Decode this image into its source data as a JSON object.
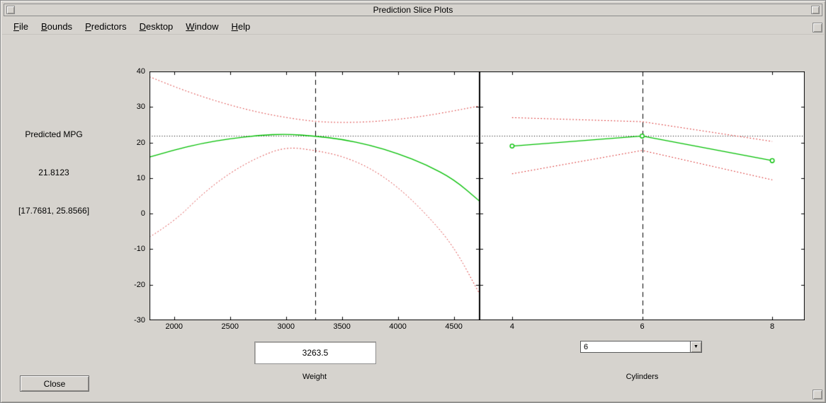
{
  "window": {
    "title": "Prediction Slice Plots"
  },
  "menu_bar": {
    "items": [
      {
        "label": "File",
        "mnemonic": "F",
        "rest": "ile"
      },
      {
        "label": "Bounds",
        "mnemonic": "B",
        "rest": "ounds"
      },
      {
        "label": "Predictors",
        "mnemonic": "P",
        "rest": "redictors"
      },
      {
        "label": "Desktop",
        "mnemonic": "D",
        "rest": "esktop"
      },
      {
        "label": "Window",
        "mnemonic": "W",
        "rest": "indow"
      },
      {
        "label": "Help",
        "mnemonic": "H",
        "rest": "elp"
      }
    ]
  },
  "info_panel": {
    "response_label": "Predicted MPG",
    "prediction_value": "21.8123",
    "confidence_interval": "[17.7681, 25.8566]"
  },
  "controls": {
    "weight_input_value": "3263.5",
    "cylinders_value": "6",
    "close_button_label": "Close"
  },
  "colors": {
    "window_bg": "#d6d3ce",
    "plot_bg": "#ffffff",
    "fit_line": "#00bf00",
    "bounds_line": "#d40000",
    "reference_line": "#000000"
  },
  "chart_data": [
    {
      "type": "line",
      "xlabel": "Weight",
      "xlim": [
        1780,
        4730
      ],
      "ylim": [
        -30,
        40
      ],
      "x_ticks": [
        2000,
        2500,
        3000,
        3500,
        4000,
        4500
      ],
      "y_ticks": [
        -30,
        -20,
        -10,
        0,
        10,
        20,
        30,
        40
      ],
      "current_x": 3263.5,
      "predicted_y": 21.8123,
      "series": [
        {
          "name": "fit",
          "style": "solid",
          "x": [
            1780,
            2000,
            2250,
            2500,
            2750,
            3000,
            3263.5,
            3500,
            3750,
            4000,
            4250,
            4500,
            4730
          ],
          "y": [
            15.9,
            17.9,
            19.8,
            21.1,
            22.0,
            22.4,
            21.81,
            20.9,
            19.3,
            16.9,
            13.8,
            9.7,
            3.5
          ]
        },
        {
          "name": "upper_bound",
          "style": "dotted",
          "x": [
            1780,
            2000,
            2250,
            2500,
            2750,
            3000,
            3263.5,
            3500,
            3750,
            4000,
            4250,
            4500,
            4730
          ],
          "y": [
            38.5,
            35.7,
            32.9,
            30.5,
            28.5,
            27.0,
            25.86,
            25.6,
            25.8,
            26.5,
            27.5,
            28.9,
            30.3
          ]
        },
        {
          "name": "lower_bound",
          "style": "dotted",
          "x": [
            1780,
            2000,
            2250,
            2500,
            2750,
            3000,
            3263.5,
            3500,
            3750,
            4000,
            4250,
            4500,
            4730
          ],
          "y": [
            -6.6,
            -2.3,
            5.5,
            11.5,
            15.9,
            18.8,
            17.77,
            16.2,
            12.9,
            7.5,
            0.0,
            -9.2,
            -22.6
          ]
        }
      ]
    },
    {
      "type": "line",
      "xlabel": "Cylinders",
      "xlim": [
        3.5,
        8.5
      ],
      "ylim": [
        -30,
        40
      ],
      "x_ticks": [
        4,
        6,
        8
      ],
      "y_ticks": [
        -30,
        -20,
        -10,
        0,
        10,
        20,
        30,
        40
      ],
      "current_x": 6,
      "predicted_y": 21.8123,
      "series": [
        {
          "name": "fit",
          "style": "solid",
          "marker": "o",
          "x": [
            4,
            6,
            8
          ],
          "y": [
            19.0,
            21.81,
            14.9
          ]
        },
        {
          "name": "upper_bound",
          "style": "dotted",
          "x": [
            4,
            6,
            8
          ],
          "y": [
            27.0,
            25.86,
            20.3
          ]
        },
        {
          "name": "lower_bound",
          "style": "dotted",
          "x": [
            4,
            6,
            8
          ],
          "y": [
            11.2,
            17.77,
            9.5
          ]
        }
      ]
    }
  ]
}
